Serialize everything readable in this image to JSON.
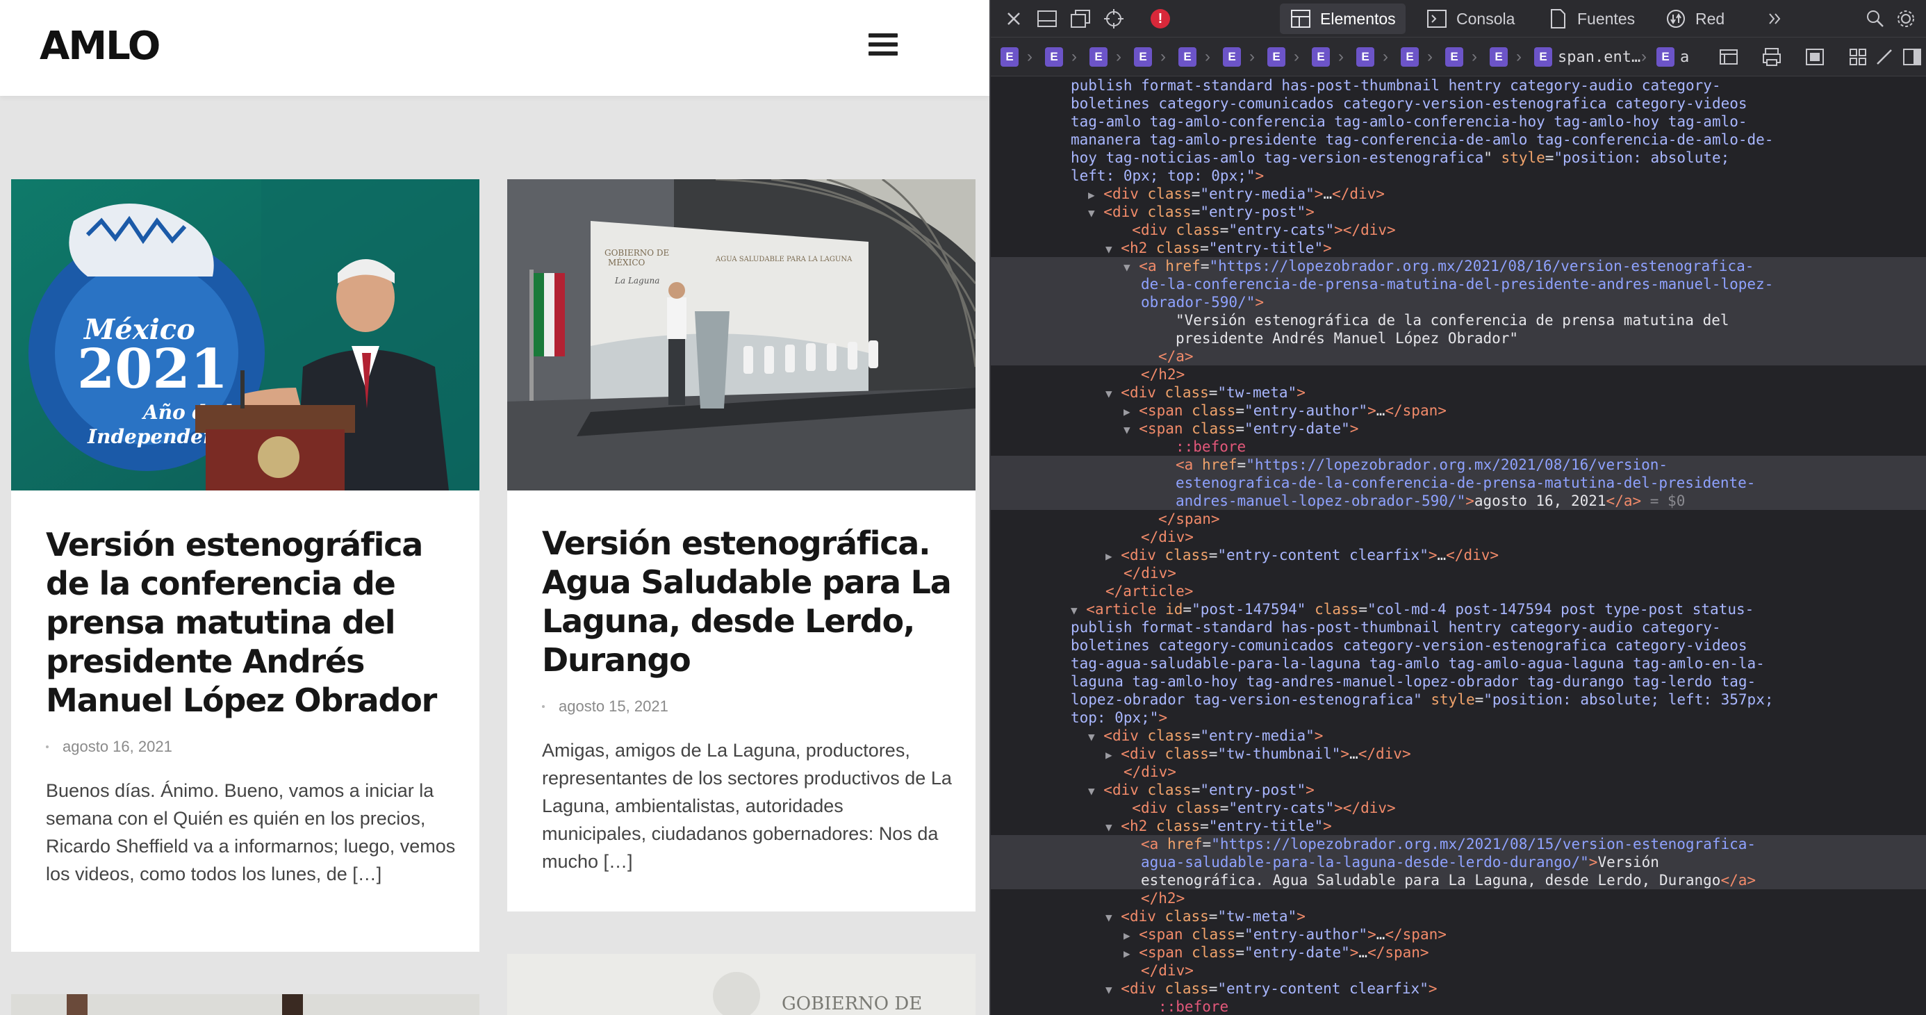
{
  "site": {
    "logo": "AMLO",
    "posts": [
      {
        "title": "Versión estenográfica de la conferencia de prensa matutina del presidente Andrés Manuel López Obrador",
        "date": "agosto 16, 2021",
        "excerpt": "Buenos días. Ánimo. Bueno, vamos a iniciar la semana con el Quién es quién en los precios, Ricardo Sheffield va a informarnos; luego, vemos los videos, como todos los lunes, de […]",
        "image": {
          "badge_text_1": "México",
          "badge_text_2": "2021",
          "badge_text_3": "Año de la",
          "badge_text_4": "Independencia"
        }
      },
      {
        "title": "Versión estenográfica. Agua Saludable para La Laguna, desde Lerdo, Durango",
        "date": "agosto 15, 2021",
        "excerpt": "Amigas, amigos de La Laguna, productores, representantes de los sectores productivos de La Laguna, ambientalistas, autoridades municipales, ciudadanos gobernadores: Nos da mucho […]",
        "image": {
          "banner_text_1": "GOBIERNO DE",
          "banner_text_2": "MÉXICO",
          "banner_text_3": "AGUA SALUDABLE PARA LA LAGUNA",
          "banner_text_4": "La Laguna"
        }
      }
    ],
    "next_image_text": "GOBIERNO DE"
  },
  "devtools": {
    "tabs": {
      "elements": "Elementos",
      "console": "Consola",
      "sources": "Fuentes",
      "network": "Red"
    },
    "error_count": "!",
    "breadcrumb": {
      "element_marker": "E",
      "span_label": "span.ent…",
      "a_label": "a"
    },
    "lines": {
      "l0": "publish format-standard has-post-thumbnail hentry category-audio category-",
      "l1": "boletines category-comunicados category-version-estenografica category-videos",
      "l2": "tag-amlo tag-amlo-conferencia tag-amlo-conferencia-hoy tag-amlo-hoy tag-amlo-",
      "l3": "mananera tag-amlo-presidente tag-conferencia-de-amlo tag-conferencia-de-amlo-de-",
      "l4a": "hoy tag-noticias-amlo tag-version-estenografica",
      "l4b": "style",
      "l4c": "\"position: absolute;",
      "l5": "left: 0px; top: 0px;\"",
      "entry_media": "\"entry-media\"",
      "entry_post": "\"entry-post\"",
      "entry_cats": "\"entry-cats\"",
      "entry_title": "\"entry-title\"",
      "href1_a": "\"https://lopezobrador.org.mx/2021/08/16/version-estenografica-",
      "href1_b": "de-la-conferencia-de-prensa-matutina-del-presidente-andres-manuel-lopez-",
      "href1_c": "obrador-590/\"",
      "text1_a": "\"Versión estenográfica de la conferencia de prensa matutina del",
      "text1_b": "presidente Andrés Manuel López Obrador\"",
      "tw_meta": "\"tw-meta\"",
      "entry_author": "\"entry-author\"",
      "entry_date": "\"entry-date\"",
      "before": "::before",
      "href2_a": "\"https://lopezobrador.org.mx/2021/08/16/version-",
      "href2_b": "estenografica-de-la-conferencia-de-prensa-matutina-del-presidente-",
      "href2_c": "andres-manuel-lopez-obrador-590/\"",
      "date_text": "agosto 16, 2021",
      "eq_sel": " = $0",
      "entry_content": "\"entry-content clearfix\"",
      "post2_id": "\"post-147594\"",
      "post2_class_a": "\"col-md-4 post-147594 post type-post status-",
      "post2_class_b": "publish format-standard has-post-thumbnail hentry category-audio category-",
      "post2_class_c": "boletines category-comunicados category-version-estenografica category-videos",
      "post2_class_d": "tag-agua-saludable-para-la-laguna tag-amlo tag-amlo-agua-laguna tag-amlo-en-la-",
      "post2_class_e": "laguna tag-amlo-hoy tag-andres-manuel-lopez-obrador tag-durango tag-lerdo tag-",
      "post2_class_f": "lopez-obrador tag-version-estenografica\"",
      "post2_style_a": "\"position: absolute; left: 357px;",
      "post2_style_b": "top: 0px;\"",
      "tw_thumbnail": "\"tw-thumbnail\"",
      "href3_a": "\"https://lopezobrador.org.mx/2021/08/15/version-estenografica-",
      "href3_b": "agua-saludable-para-la-laguna-desde-lerdo-durango/\"",
      "text3_a": "Versión",
      "text3_b": "estenográfica. Agua Saludable para La Laguna, desde Lerdo, Durango"
    }
  }
}
